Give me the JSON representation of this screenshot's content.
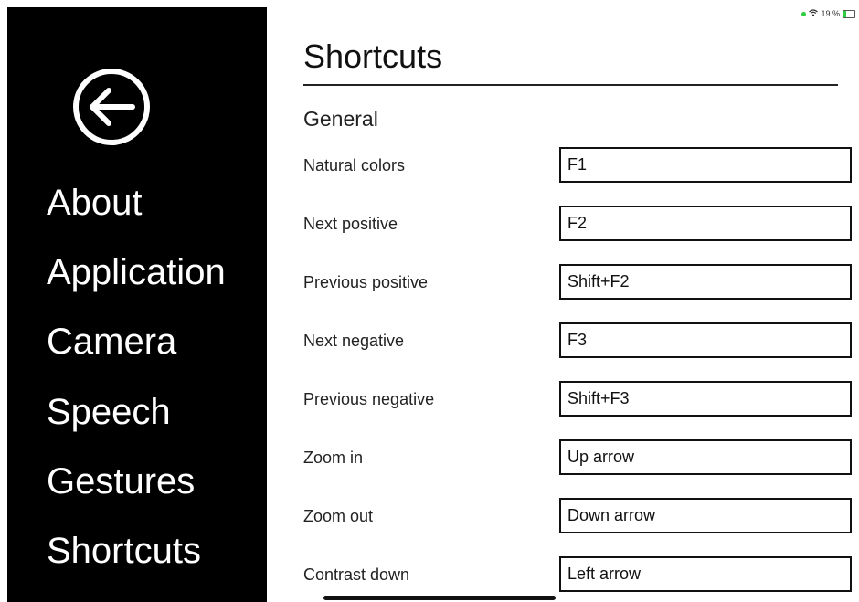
{
  "status_bar": {
    "battery_text": "19 %"
  },
  "sidebar": {
    "back_icon": "arrow-left-circle-icon",
    "items": [
      {
        "label": "About"
      },
      {
        "label": "Application"
      },
      {
        "label": "Camera"
      },
      {
        "label": "Speech"
      },
      {
        "label": "Gestures"
      },
      {
        "label": "Shortcuts"
      }
    ]
  },
  "main": {
    "title": "Shortcuts",
    "section": "General",
    "shortcuts": [
      {
        "label": "Natural colors",
        "value": "F1"
      },
      {
        "label": "Next positive",
        "value": "F2"
      },
      {
        "label": "Previous positive",
        "value": "Shift+F2"
      },
      {
        "label": "Next negative",
        "value": "F3"
      },
      {
        "label": "Previous negative",
        "value": "Shift+F3"
      },
      {
        "label": "Zoom in",
        "value": "Up arrow"
      },
      {
        "label": "Zoom out",
        "value": "Down arrow"
      },
      {
        "label": "Contrast down",
        "value": "Left arrow"
      }
    ]
  },
  "colors": {
    "sidebar_background": "#000000",
    "sidebar_text": "#ffffff",
    "status_dot": "#2ecc40"
  }
}
